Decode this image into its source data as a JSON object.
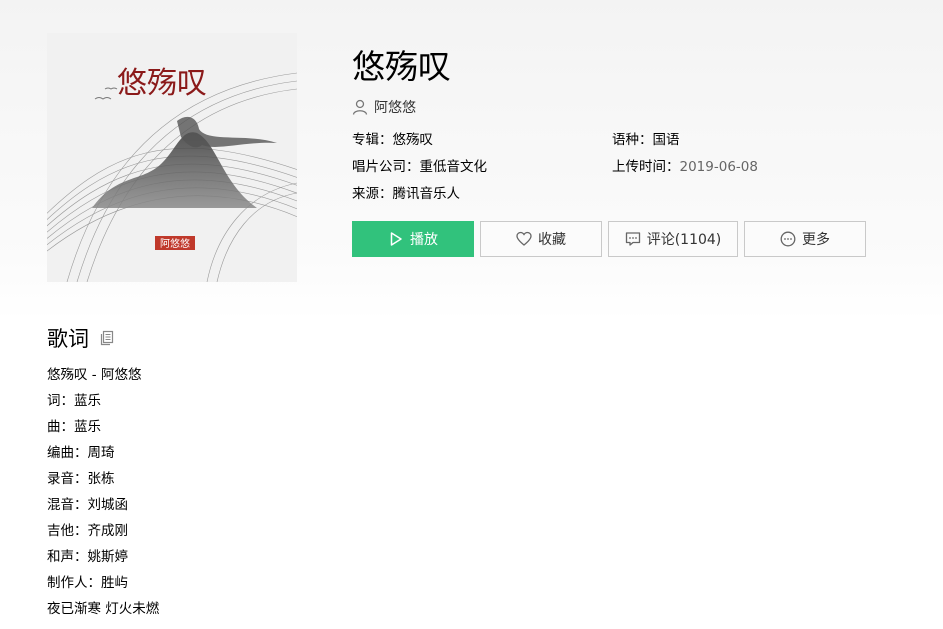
{
  "song": {
    "title": "悠殇叹",
    "singer": "阿悠悠",
    "cover_text": "悠殇叹",
    "cover_stamp": "阿悠悠"
  },
  "info": {
    "album": "专辑：悠殇叹",
    "language": "语种：国语",
    "label": "唱片公司：重低音文化",
    "upload_label": "上传时间：",
    "upload_date": "2019-06-08",
    "source": "来源：腾讯音乐人"
  },
  "buttons": {
    "play": "播放",
    "favorite": "收藏",
    "comment": "评论(1104)",
    "more": "更多"
  },
  "lyrics": {
    "heading": "歌词",
    "lines": [
      "悠殇叹 - 阿悠悠",
      "词：蓝乐",
      "曲：蓝乐",
      "编曲：周琦",
      "录音：张栋",
      "混音：刘城函",
      "吉他：齐成刚",
      "和声：姚斯婷",
      "制作人：胜屿",
      "夜已渐寒 灯火未燃"
    ]
  },
  "colors": {
    "play_button": "#31c27c",
    "stamp_red": "#c0392b"
  },
  "icons": {
    "singer": "person-icon",
    "play": "play-icon",
    "favorite": "heart-icon",
    "comment": "comment-icon",
    "more": "more-dots-icon",
    "copy": "copy-icon"
  }
}
